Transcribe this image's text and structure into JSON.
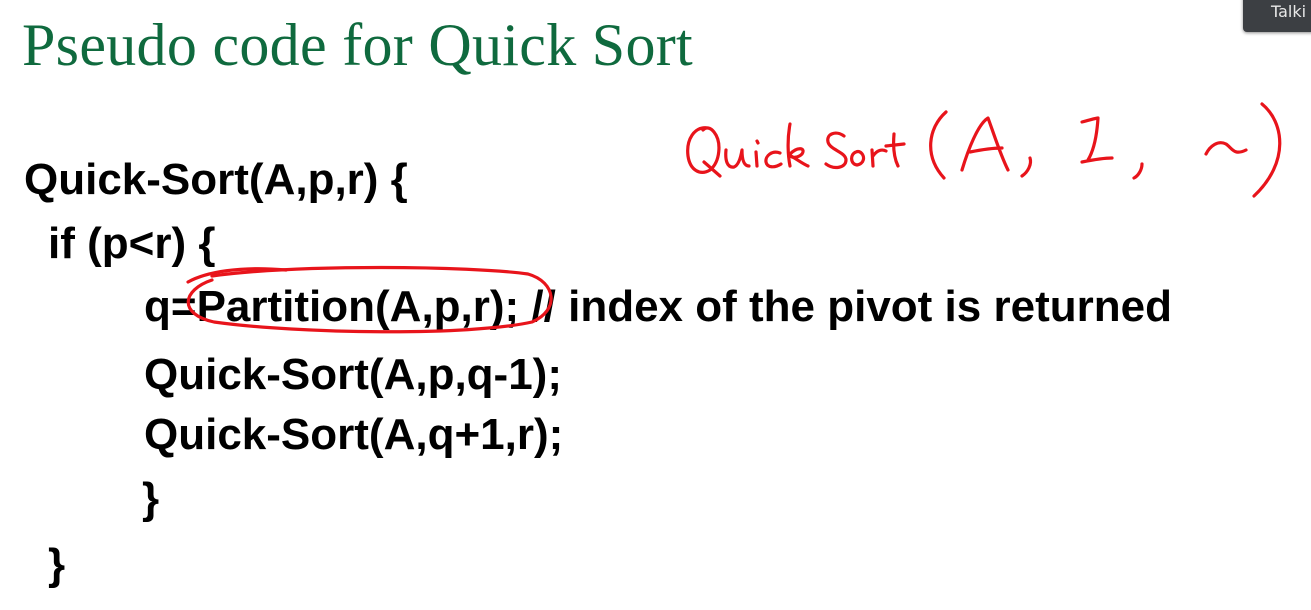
{
  "title": "Pseudo code for Quick Sort",
  "code_lines": [
    "Quick-Sort(A,p,r) {",
    "if (p<r) {",
    "q=Partition(A,p,r); // index of the pivot is returned",
    "Quick-Sort(A,p,q-1);",
    "Quick-Sort(A,q+1,r);",
    "}",
    "}"
  ],
  "annotation": {
    "handwritten_text": "QuickSort(A, 1, n)",
    "ink_color": "#e8141b",
    "circled_term": "Partition(A,p,r)"
  },
  "overlay_badge": {
    "label": "Talki"
  },
  "colors": {
    "title": "#0f6a3e",
    "code": "#000000",
    "background": "#ffffff"
  }
}
